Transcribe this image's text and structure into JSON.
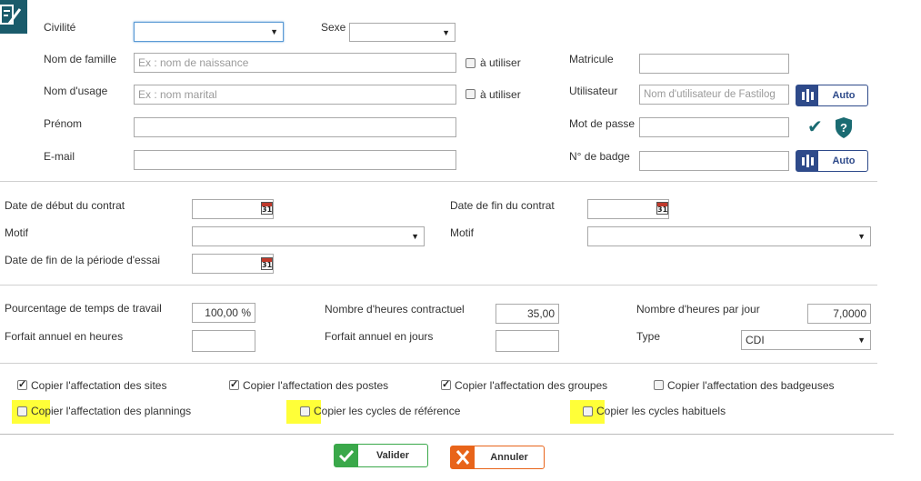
{
  "identity": {
    "civilite_label": "Civilité",
    "sexe_label": "Sexe",
    "nom_famille_label": "Nom de famille",
    "nom_famille_placeholder": "Ex : nom de naissance",
    "a_utiliser_1": "à utiliser",
    "nom_usage_label": "Nom d'usage",
    "nom_usage_placeholder": "Ex : nom marital",
    "a_utiliser_2": "à utiliser",
    "prenom_label": "Prénom",
    "email_label": "E-mail",
    "matricule_label": "Matricule",
    "utilisateur_label": "Utilisateur",
    "utilisateur_placeholder": "Nom d'utilisateur de Fastilog",
    "auto_label": "Auto",
    "mot_de_passe_label": "Mot de passe",
    "badge_label": "N° de badge",
    "auto_label_2": "Auto"
  },
  "contract": {
    "date_debut_label": "Date de début du contrat",
    "date_fin_label": "Date de fin du contrat",
    "motif_label_1": "Motif",
    "motif_label_2": "Motif",
    "fin_essai_label": "Date de fin de la période d'essai",
    "calendar_day": "31"
  },
  "hours": {
    "pourcentage_label": "Pourcentage de temps de travail",
    "pourcentage_value": "100,00 %",
    "heures_contractuel_label": "Nombre d'heures contractuel",
    "heures_contractuel_value": "35,00",
    "heures_jour_label": "Nombre d'heures par jour",
    "heures_jour_value": "7,0000",
    "forfait_heures_label": "Forfait annuel en heures",
    "forfait_jours_label": "Forfait annuel en jours",
    "type_label": "Type",
    "type_value": "CDI"
  },
  "copy_options": [
    {
      "label": "Copier l'affectation des sites",
      "checked": true
    },
    {
      "label": "Copier l'affectation des postes",
      "checked": true
    },
    {
      "label": "Copier l'affectation des groupes",
      "checked": true
    },
    {
      "label": "Copier l'affectation des badgeuses",
      "checked": false
    },
    {
      "label": "Copier l'affectation des plannings",
      "checked": false
    },
    {
      "label": "Copier les cycles de référence",
      "checked": false
    },
    {
      "label": "Copier les cycles habituels",
      "checked": false
    }
  ],
  "actions": {
    "valider_label": "Valider",
    "annuler_label": "Annuler"
  },
  "colors": {
    "header_icon_bg": "#1a5b6b",
    "auto_button": "#2e4a8a",
    "valider_green": "#3aa84a",
    "annuler_orange": "#e8641a",
    "highlight": "#ffff38",
    "check_teal": "#1a6b72"
  }
}
